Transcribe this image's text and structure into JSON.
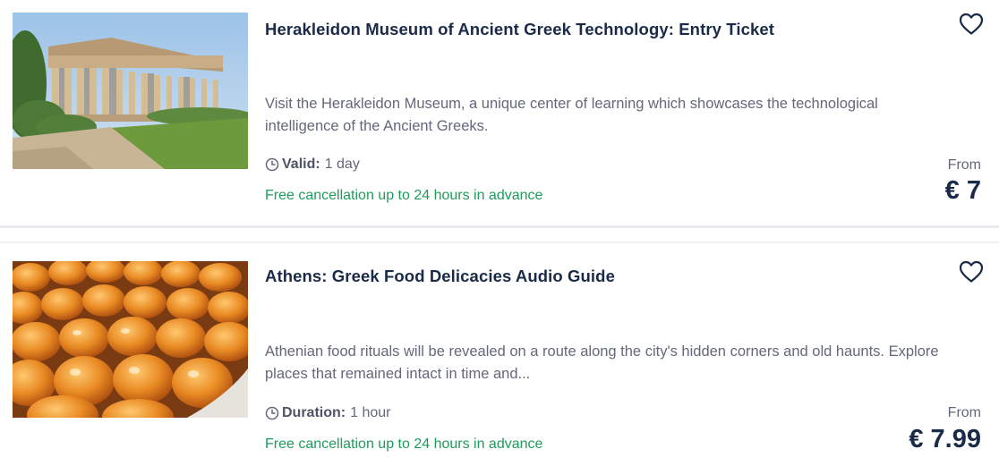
{
  "activities": [
    {
      "title": "Herakleidon Museum of Ancient Greek Technology: Entry Ticket",
      "description": "Visit the Herakleidon Museum, a unique center of learning which showcases the technological intelligence of the Ancient Greeks.",
      "meta_label": "Valid:",
      "meta_value": "1 day",
      "cancellation": "Free cancellation up to 24 hours in advance",
      "from_label": "From",
      "price": "€ 7",
      "image": "greek-temple-photo",
      "icon": "heart-icon"
    },
    {
      "title": "Athens: Greek Food Delicacies Audio Guide",
      "description": "Athenian food rituals will be revealed on a route along the city's hidden corners and old haunts. Explore places that remained intact in time and...",
      "meta_label": "Duration:",
      "meta_value": "1 hour",
      "cancellation": "Free cancellation up to 24 hours in advance",
      "from_label": "From",
      "price": "€ 7.99",
      "image": "greek-sweets-photo",
      "icon": "heart-icon"
    }
  ],
  "colors": {
    "title": "#1a2b49",
    "text": "#63687a",
    "cancellation": "#1f9b5b",
    "divider": "#e9ebee"
  }
}
